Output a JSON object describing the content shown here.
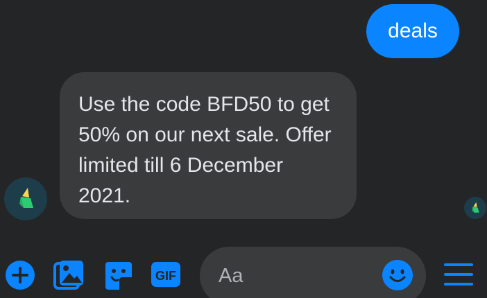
{
  "conversation": {
    "sent_message": "deals",
    "received_message": "Use the code BFD50 to get 50% on our next sale. Offer limited till 6 December 2021."
  },
  "composer": {
    "placeholder": "Aa"
  },
  "toolbar": {
    "gif_label": "GIF",
    "icons": [
      "plus-icon",
      "photo-icon",
      "sticker-icon",
      "gif-icon",
      "emoji-icon",
      "menu-icon"
    ]
  },
  "colors": {
    "background": "#242526",
    "accent": "#0a84ff",
    "incoming_bubble": "#3a3b3c",
    "text": "#e4e6eb",
    "avatar_background": "#1d3d4b",
    "logo_green": "#2ecc71",
    "logo_yellow": "#ffd54a"
  }
}
